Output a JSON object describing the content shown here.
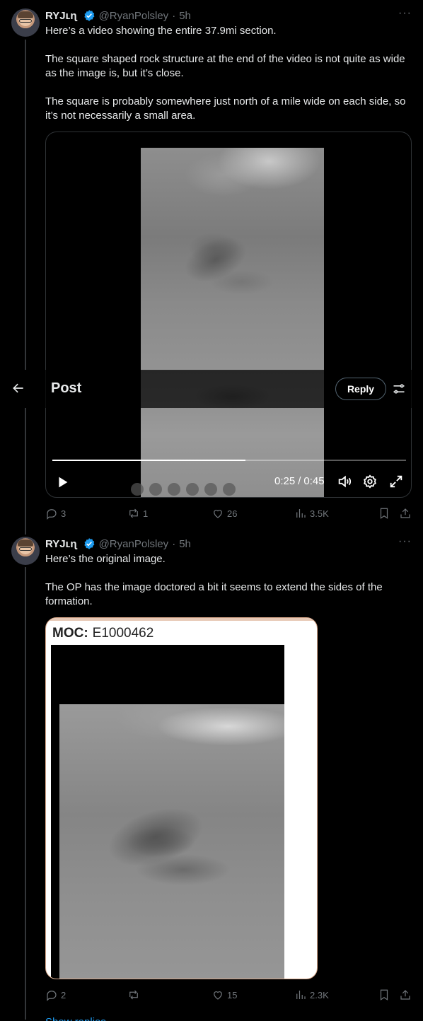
{
  "tweets": [
    {
      "name": "RYJʟɳ",
      "handle": "@RyanPolsley",
      "time": "5h",
      "text": "Here’s a video showing the entire 37.9mi section.\n\nThe square shaped rock structure at the end of the video is not quite as wide as the image is, but it’s close.\n\nThe square is probably somewhere just north of a mile wide on each side, so it’s not necessarily a small area.",
      "video": {
        "current_time": "0:25",
        "duration": "0:45",
        "progress": 0.545
      },
      "stats": {
        "replies": "3",
        "reposts": "1",
        "likes": "26",
        "views": "3.5K"
      }
    },
    {
      "name": "RYJʟɳ",
      "handle": "@RyanPolsley",
      "time": "5h",
      "text": "Here’s the original image.\n\nThe OP has the image doctored a bit it seems to extend the sides of the formation.",
      "image": {
        "moc_label": "MOC:",
        "moc_id": "E1000462"
      },
      "stats": {
        "replies": "2",
        "reposts": "",
        "likes": "15",
        "views": "2.3K"
      }
    }
  ],
  "header": {
    "title": "Post",
    "reply_label": "Reply"
  },
  "show_replies": "Show replies",
  "colors": {
    "verified": "#1d9bf0",
    "muted": "#71767b",
    "text": "#e7e9ea"
  },
  "icons": [
    "back-arrow-icon",
    "more-icon",
    "verified-icon",
    "play-icon",
    "volume-icon",
    "settings-icon",
    "fullscreen-icon",
    "reply-icon",
    "repost-icon",
    "like-icon",
    "views-icon",
    "bookmark-icon",
    "share-icon",
    "filter-icon"
  ]
}
